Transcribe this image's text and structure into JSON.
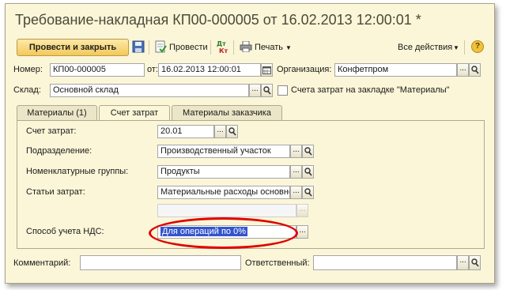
{
  "window": {
    "title": "Требование-накладная КП00-000005 от 16.02.2013 12:00:01 *"
  },
  "toolbar": {
    "post_close": "Провести и закрыть",
    "post": "Провести",
    "print": "Печать",
    "all_actions": "Все действия",
    "help": "?"
  },
  "header": {
    "number_label": "Номер:",
    "number_value": "КП00-000005",
    "date_label": "от:",
    "date_value": "16.02.2013 12:00:01",
    "org_label": "Организация:",
    "org_value": "Конфетпром",
    "warehouse_label": "Склад:",
    "warehouse_value": "Основной склад",
    "accounts_checkbox_label": "Счета затрат на закладке \"Материалы\""
  },
  "tabs": [
    {
      "label": "Материалы (1)"
    },
    {
      "label": "Счет затрат"
    },
    {
      "label": "Материалы заказчика"
    }
  ],
  "costs": {
    "account_label": "Счет затрат:",
    "account_value": "20.01",
    "division_label": "Подразделение:",
    "division_value": "Производственный участок",
    "nomgroup_label": "Номенклатурные группы:",
    "nomgroup_value": "Продукты",
    "cost_item_label": "Статьи затрат:",
    "cost_item_value": "Материальные расходы основно",
    "vat_label": "Способ учета НДС:",
    "vat_value": "Для операций по 0%"
  },
  "footer": {
    "comment_label": "Комментарий:",
    "comment_value": "",
    "responsible_label": "Ответственный:",
    "responsible_value": ""
  },
  "colors": {
    "window_bg": "#fbf6d8",
    "accent_button": "#f3c85a",
    "highlight_oval": "#e00000",
    "selection": "#3355cc"
  }
}
